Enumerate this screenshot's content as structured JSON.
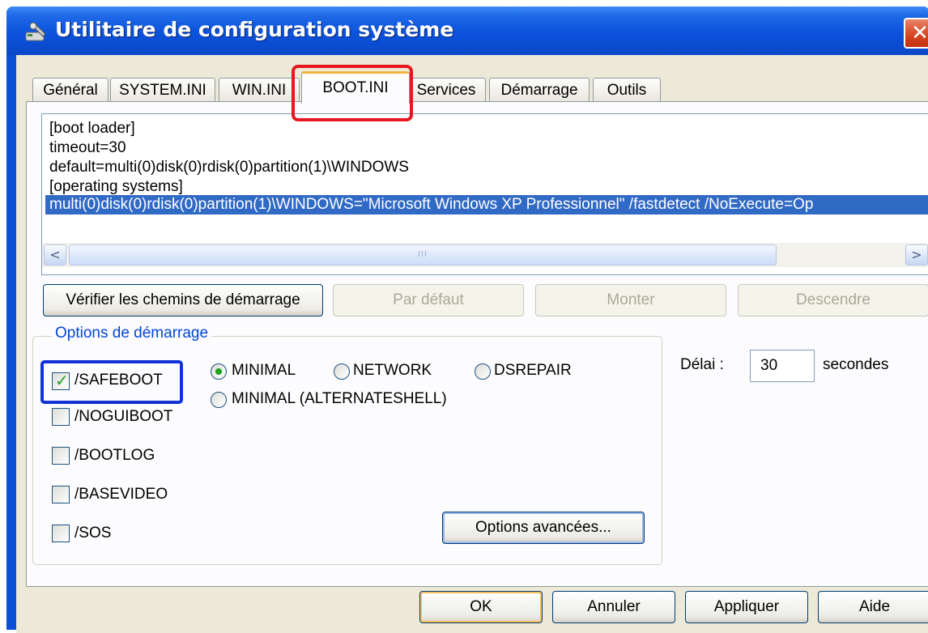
{
  "window": {
    "title": "Utilitaire de configuration système",
    "close_glyph": "✕"
  },
  "tabs": [
    {
      "label": "Général"
    },
    {
      "label": "SYSTEM.INI"
    },
    {
      "label": "WIN.INI"
    },
    {
      "label": "BOOT.INI",
      "active": true
    },
    {
      "label": "Services"
    },
    {
      "label": "Démarrage"
    },
    {
      "label": "Outils"
    }
  ],
  "editor": {
    "lines": [
      "[boot loader]",
      "timeout=30",
      "default=multi(0)disk(0)rdisk(0)partition(1)\\WINDOWS",
      "[operating systems]",
      "multi(0)disk(0)rdisk(0)partition(1)\\WINDOWS=\"Microsoft Windows XP Professionnel\" /fastdetect /NoExecute=Op"
    ],
    "scroll_left_glyph": "<",
    "scroll_right_glyph": ">",
    "thumb_grip": "III"
  },
  "action_buttons": {
    "verify": "Vérifier les chemins de démarrage",
    "default": "Par défaut",
    "up": "Monter",
    "down": "Descendre"
  },
  "boot_options": {
    "legend": "Options de démarrage",
    "checkboxes": [
      {
        "label": "/SAFEBOOT",
        "checked": true
      },
      {
        "label": "/NOGUIBOOT",
        "checked": false
      },
      {
        "label": "/BOOTLOG",
        "checked": false
      },
      {
        "label": "/BASEVIDEO",
        "checked": false
      },
      {
        "label": "/SOS",
        "checked": false
      }
    ],
    "radios": [
      {
        "label": "MINIMAL",
        "selected": true
      },
      {
        "label": "NETWORK",
        "selected": false
      },
      {
        "label": "DSREPAIR",
        "selected": false
      },
      {
        "label": "MINIMAL (ALTERNATESHELL)",
        "selected": false
      }
    ],
    "advanced_button": "Options avancées..."
  },
  "delay": {
    "label": "Délai :",
    "value": "30",
    "unit": "secondes"
  },
  "footer_buttons": {
    "ok": "OK",
    "cancel": "Annuler",
    "apply": "Appliquer",
    "help": "Aide"
  },
  "colors": {
    "titlebar": "#0a52dc",
    "selection": "#316ac5",
    "tab_highlight": "#e8171f",
    "safeboot_highlight": "#1133d6",
    "check_green": "#21a121"
  }
}
